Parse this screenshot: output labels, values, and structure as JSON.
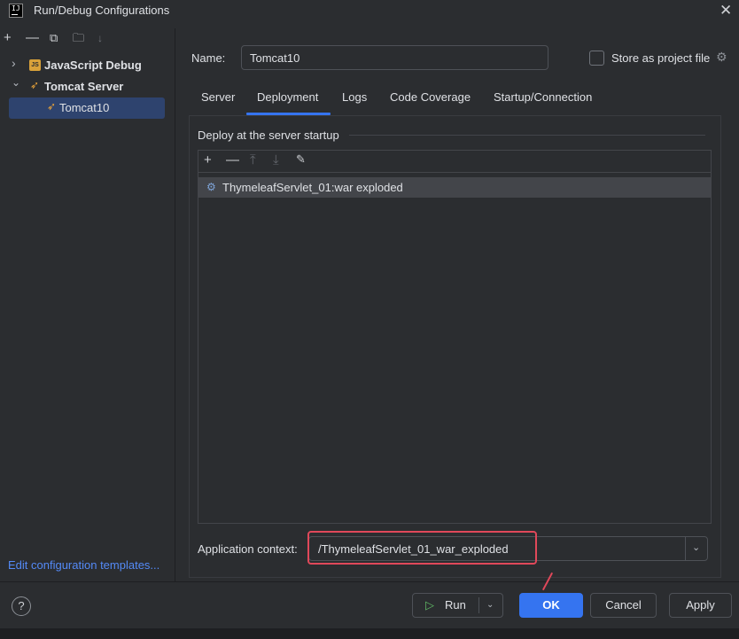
{
  "window": {
    "title": "Run/Debug Configurations",
    "app_icon_text": "IJ",
    "close_glyph": "✕"
  },
  "left_toolbar": {
    "icons": [
      "add-icon",
      "remove-icon",
      "copy-icon",
      "new-folder-icon",
      "sort-icon"
    ],
    "glyphs": [
      "+",
      "—",
      "⧉",
      "🗀",
      "↓"
    ]
  },
  "tree": {
    "javascript_debug": "JavaScript Debug",
    "js_badge": "JS",
    "tomcat_server": "Tomcat Server",
    "tomcat10": "Tomcat10",
    "chevron_collapsed": "›",
    "chevron_expanded": "⌄"
  },
  "edit_templates_link": "Edit configuration templates...",
  "name_field": {
    "label": "Name:",
    "value": "Tomcat10"
  },
  "store_as_project_file": {
    "label": "Store as project file",
    "checked": false
  },
  "tabs": {
    "items": [
      "Server",
      "Deployment",
      "Logs",
      "Code Coverage",
      "Startup/Connection"
    ],
    "active": "Deployment"
  },
  "deployment": {
    "group_title": "Deploy at the server startup",
    "toolbar_icons": [
      "add-icon",
      "remove-icon",
      "move-up-icon",
      "move-down-icon",
      "edit-icon"
    ],
    "artifacts": [
      "ThymeleafServlet_01:war exploded"
    ],
    "application_context_label": "Application context:",
    "application_context_value": "/ThymeleafServlet_01_war_exploded"
  },
  "footer": {
    "help_glyph": "?",
    "run_label": "Run",
    "ok_label": "OK",
    "cancel_label": "Cancel",
    "apply_label": "Apply"
  },
  "colors": {
    "accent": "#3574f0",
    "selection": "#2e436e",
    "link": "#548af7",
    "annotation_red": "#e0485a"
  }
}
